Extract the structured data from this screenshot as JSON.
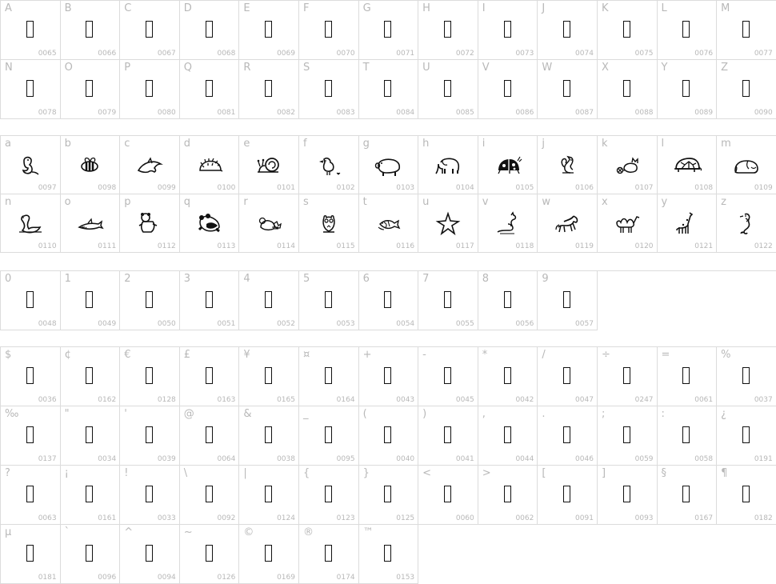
{
  "upper": [
    {
      "label": "A",
      "code": "0065"
    },
    {
      "label": "B",
      "code": "0066"
    },
    {
      "label": "C",
      "code": "0067"
    },
    {
      "label": "D",
      "code": "0068"
    },
    {
      "label": "E",
      "code": "0069"
    },
    {
      "label": "F",
      "code": "0070"
    },
    {
      "label": "G",
      "code": "0071"
    },
    {
      "label": "H",
      "code": "0072"
    },
    {
      "label": "I",
      "code": "0073"
    },
    {
      "label": "J",
      "code": "0074"
    },
    {
      "label": "K",
      "code": "0075"
    },
    {
      "label": "L",
      "code": "0076"
    },
    {
      "label": "M",
      "code": "0077"
    },
    {
      "label": "N",
      "code": "0078"
    },
    {
      "label": "O",
      "code": "0079"
    },
    {
      "label": "P",
      "code": "0080"
    },
    {
      "label": "Q",
      "code": "0081"
    },
    {
      "label": "R",
      "code": "0082"
    },
    {
      "label": "S",
      "code": "0083"
    },
    {
      "label": "T",
      "code": "0084"
    },
    {
      "label": "U",
      "code": "0085"
    },
    {
      "label": "V",
      "code": "0086"
    },
    {
      "label": "W",
      "code": "0087"
    },
    {
      "label": "X",
      "code": "0088"
    },
    {
      "label": "Y",
      "code": "0089"
    },
    {
      "label": "Z",
      "code": "0090"
    }
  ],
  "lower": [
    {
      "label": "a",
      "code": "0097",
      "glyph": "seal-icon"
    },
    {
      "label": "b",
      "code": "0098",
      "glyph": "bee-icon"
    },
    {
      "label": "c",
      "code": "0099",
      "glyph": "dolphin-icon"
    },
    {
      "label": "d",
      "code": "0100",
      "glyph": "hedgehog-icon"
    },
    {
      "label": "e",
      "code": "0101",
      "glyph": "snail-icon"
    },
    {
      "label": "f",
      "code": "0102",
      "glyph": "bird-icon"
    },
    {
      "label": "g",
      "code": "0103",
      "glyph": "pig-icon"
    },
    {
      "label": "h",
      "code": "0104",
      "glyph": "elephant-icon"
    },
    {
      "label": "i",
      "code": "0105",
      "glyph": "ladybug-icon"
    },
    {
      "label": "j",
      "code": "0106",
      "glyph": "squirrel-icon"
    },
    {
      "label": "k",
      "code": "0107",
      "glyph": "cat-icon"
    },
    {
      "label": "l",
      "code": "0108",
      "glyph": "turtle-icon"
    },
    {
      "label": "m",
      "code": "0109",
      "glyph": "sleeping-dog-icon"
    },
    {
      "label": "n",
      "code": "0110",
      "glyph": "swan-icon"
    },
    {
      "label": "o",
      "code": "0111",
      "glyph": "shark-icon"
    },
    {
      "label": "p",
      "code": "0112",
      "glyph": "teddy-bear-icon"
    },
    {
      "label": "q",
      "code": "0113",
      "glyph": "panda-icon"
    },
    {
      "label": "r",
      "code": "0114",
      "glyph": "mouse-icon"
    },
    {
      "label": "s",
      "code": "0115",
      "glyph": "owl-icon"
    },
    {
      "label": "t",
      "code": "0116",
      "glyph": "fish-icon"
    },
    {
      "label": "u",
      "code": "0117",
      "glyph": "starfish-icon"
    },
    {
      "label": "v",
      "code": "0118",
      "glyph": "kangaroo-icon"
    },
    {
      "label": "w",
      "code": "0119",
      "glyph": "horse-icon"
    },
    {
      "label": "x",
      "code": "0120",
      "glyph": "camel-icon"
    },
    {
      "label": "y",
      "code": "0121",
      "glyph": "giraffe-icon"
    },
    {
      "label": "z",
      "code": "0122",
      "glyph": "seahorse-icon"
    }
  ],
  "digits": [
    {
      "label": "0",
      "code": "0048"
    },
    {
      "label": "1",
      "code": "0049"
    },
    {
      "label": "2",
      "code": "0050"
    },
    {
      "label": "3",
      "code": "0051"
    },
    {
      "label": "4",
      "code": "0052"
    },
    {
      "label": "5",
      "code": "0053"
    },
    {
      "label": "6",
      "code": "0054"
    },
    {
      "label": "7",
      "code": "0055"
    },
    {
      "label": "8",
      "code": "0056"
    },
    {
      "label": "9",
      "code": "0057"
    }
  ],
  "symbols": [
    {
      "label": "$",
      "code": "0036"
    },
    {
      "label": "¢",
      "code": "0162"
    },
    {
      "label": "€",
      "code": "0128"
    },
    {
      "label": "£",
      "code": "0163"
    },
    {
      "label": "¥",
      "code": "0165"
    },
    {
      "label": "¤",
      "code": "0164"
    },
    {
      "label": "+",
      "code": "0043"
    },
    {
      "label": "-",
      "code": "0045"
    },
    {
      "label": "*",
      "code": "0042"
    },
    {
      "label": "/",
      "code": "0047"
    },
    {
      "label": "÷",
      "code": "0247"
    },
    {
      "label": "=",
      "code": "0061"
    },
    {
      "label": "%",
      "code": "0037"
    },
    {
      "label": "‰",
      "code": "0137"
    },
    {
      "label": "\"",
      "code": "0034"
    },
    {
      "label": "'",
      "code": "0039"
    },
    {
      "label": "@",
      "code": "0064"
    },
    {
      "label": "&",
      "code": "0038"
    },
    {
      "label": "_",
      "code": "0095"
    },
    {
      "label": "(",
      "code": "0040"
    },
    {
      "label": ")",
      "code": "0041"
    },
    {
      "label": ",",
      "code": "0044"
    },
    {
      "label": ".",
      "code": "0046"
    },
    {
      "label": ";",
      "code": "0059"
    },
    {
      "label": ":",
      "code": "0058"
    },
    {
      "label": "¿",
      "code": "0191"
    },
    {
      "label": "?",
      "code": "0063"
    },
    {
      "label": "¡",
      "code": "0161"
    },
    {
      "label": "!",
      "code": "0033"
    },
    {
      "label": "\\",
      "code": "0092"
    },
    {
      "label": "|",
      "code": "0124"
    },
    {
      "label": "{",
      "code": "0123"
    },
    {
      "label": "}",
      "code": "0125"
    },
    {
      "label": "<",
      "code": "0060"
    },
    {
      "label": ">",
      "code": "0062"
    },
    {
      "label": "[",
      "code": "0091"
    },
    {
      "label": "]",
      "code": "0093"
    },
    {
      "label": "§",
      "code": "0167"
    },
    {
      "label": "¶",
      "code": "0182"
    },
    {
      "label": "µ",
      "code": "0181"
    },
    {
      "label": "`",
      "code": "0096"
    },
    {
      "label": "^",
      "code": "0094"
    },
    {
      "label": "~",
      "code": "0126"
    },
    {
      "label": "©",
      "code": "0169"
    },
    {
      "label": "®",
      "code": "0174"
    },
    {
      "label": "™",
      "code": "0153"
    }
  ]
}
